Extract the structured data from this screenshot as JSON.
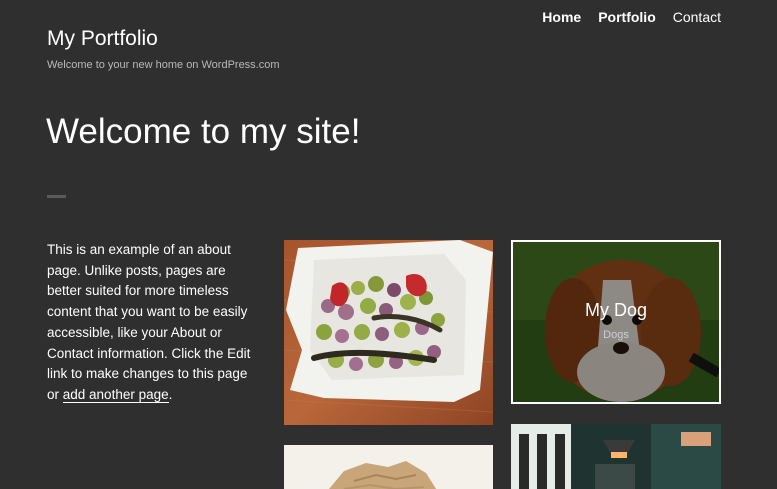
{
  "nav": {
    "items": [
      {
        "label": "Home"
      },
      {
        "label": "Portfolio"
      },
      {
        "label": "Contact"
      }
    ]
  },
  "site": {
    "title": "My Portfolio",
    "tagline": "Welcome to your new home on WordPress.com"
  },
  "page": {
    "title": "Welcome to my site!"
  },
  "intro": {
    "text": "This is an example of an about page. Unlike posts, pages are better suited for more timeless content that you want to be easily accessible, like your About or Contact information. Click the Edit link to make changes to this page or ",
    "link": "add another page",
    "end": "."
  },
  "portfolio": {
    "featured": {
      "title": "My Dog",
      "category": "Dogs"
    }
  },
  "colors": {
    "background": "#2f2f2f",
    "text": "#ffffff",
    "muted": "#b9b9b9"
  }
}
